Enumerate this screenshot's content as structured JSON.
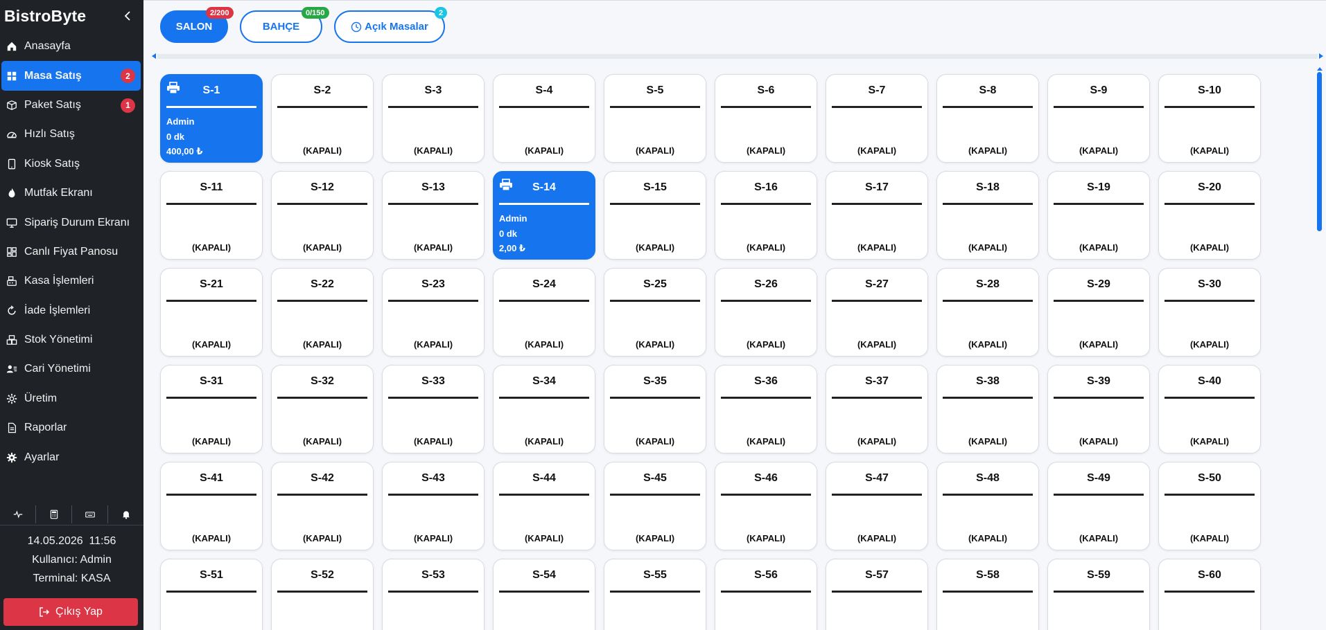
{
  "sidebar": {
    "brand": "BistroByte",
    "items": [
      {
        "label": "Anasayfa",
        "icon": "home-icon"
      },
      {
        "label": "Masa Satış",
        "icon": "grid-icon",
        "badge": "2",
        "active": true
      },
      {
        "label": "Paket Satış",
        "icon": "box-icon",
        "badge": "1"
      },
      {
        "label": "Hızlı Satış",
        "icon": "speedometer-icon"
      },
      {
        "label": "Kiosk Satış",
        "icon": "tablet-icon"
      },
      {
        "label": "Mutfak Ekranı",
        "icon": "flame-icon"
      },
      {
        "label": "Sipariş Durum Ekranı",
        "icon": "monitor-icon"
      },
      {
        "label": "Canlı Fiyat Panosu",
        "icon": "dashboard-icon"
      },
      {
        "label": "Kasa İşlemleri",
        "icon": "cash-register-icon"
      },
      {
        "label": "İade İşlemleri",
        "icon": "refresh-icon"
      },
      {
        "label": "Stok Yönetimi",
        "icon": "boxes-icon"
      },
      {
        "label": "Cari Yönetimi",
        "icon": "user-card-icon"
      },
      {
        "label": "Üretim",
        "icon": "gear-icon"
      },
      {
        "label": "Raporlar",
        "icon": "document-icon"
      },
      {
        "label": "Ayarlar",
        "icon": "settings-icon"
      }
    ],
    "tools": [
      "activity-icon",
      "calculator-icon",
      "keyboard-icon",
      "bell-icon"
    ],
    "datetime": "14.05.2026  11:56",
    "user_line": "Kullanıcı: Admin",
    "terminal_line": "Terminal: KASA",
    "logout_label": "Çıkış Yap"
  },
  "zones": [
    {
      "label": "SALON",
      "badge": "2/200",
      "badge_color": "#dc3545",
      "active": true
    },
    {
      "label": "BAHÇE",
      "badge": "0/150",
      "badge_color": "#28a745",
      "active": false
    },
    {
      "label": "Açık Masalar",
      "badge": "2",
      "badge_color": "#1cc6e3",
      "active": false,
      "icon": "clock-icon"
    }
  ],
  "closed_label": "(KAPALI)",
  "tables": [
    {
      "name": "S-1",
      "open": true,
      "user": "Admin",
      "time": "0 dk",
      "amount": "400,00 ₺"
    },
    {
      "name": "S-2"
    },
    {
      "name": "S-3"
    },
    {
      "name": "S-4"
    },
    {
      "name": "S-5"
    },
    {
      "name": "S-6"
    },
    {
      "name": "S-7"
    },
    {
      "name": "S-8"
    },
    {
      "name": "S-9"
    },
    {
      "name": "S-10"
    },
    {
      "name": "S-11"
    },
    {
      "name": "S-12"
    },
    {
      "name": "S-13"
    },
    {
      "name": "S-14",
      "open": true,
      "user": "Admin",
      "time": "0 dk",
      "amount": "2,00 ₺"
    },
    {
      "name": "S-15"
    },
    {
      "name": "S-16"
    },
    {
      "name": "S-17"
    },
    {
      "name": "S-18"
    },
    {
      "name": "S-19"
    },
    {
      "name": "S-20"
    },
    {
      "name": "S-21"
    },
    {
      "name": "S-22"
    },
    {
      "name": "S-23"
    },
    {
      "name": "S-24"
    },
    {
      "name": "S-25"
    },
    {
      "name": "S-26"
    },
    {
      "name": "S-27"
    },
    {
      "name": "S-28"
    },
    {
      "name": "S-29"
    },
    {
      "name": "S-30"
    },
    {
      "name": "S-31"
    },
    {
      "name": "S-32"
    },
    {
      "name": "S-33"
    },
    {
      "name": "S-34"
    },
    {
      "name": "S-35"
    },
    {
      "name": "S-36"
    },
    {
      "name": "S-37"
    },
    {
      "name": "S-38"
    },
    {
      "name": "S-39"
    },
    {
      "name": "S-40"
    },
    {
      "name": "S-41"
    },
    {
      "name": "S-42"
    },
    {
      "name": "S-43"
    },
    {
      "name": "S-44"
    },
    {
      "name": "S-45"
    },
    {
      "name": "S-46"
    },
    {
      "name": "S-47"
    },
    {
      "name": "S-48"
    },
    {
      "name": "S-49"
    },
    {
      "name": "S-50"
    },
    {
      "name": "S-51"
    },
    {
      "name": "S-52"
    },
    {
      "name": "S-53"
    },
    {
      "name": "S-54"
    },
    {
      "name": "S-55"
    },
    {
      "name": "S-56"
    },
    {
      "name": "S-57"
    },
    {
      "name": "S-58"
    },
    {
      "name": "S-59"
    },
    {
      "name": "S-60"
    }
  ],
  "colors": {
    "accent": "#1675ee",
    "danger": "#dc3545",
    "success": "#28a745",
    "info": "#1cc6e3",
    "sidebar_bg": "#1f2328"
  }
}
